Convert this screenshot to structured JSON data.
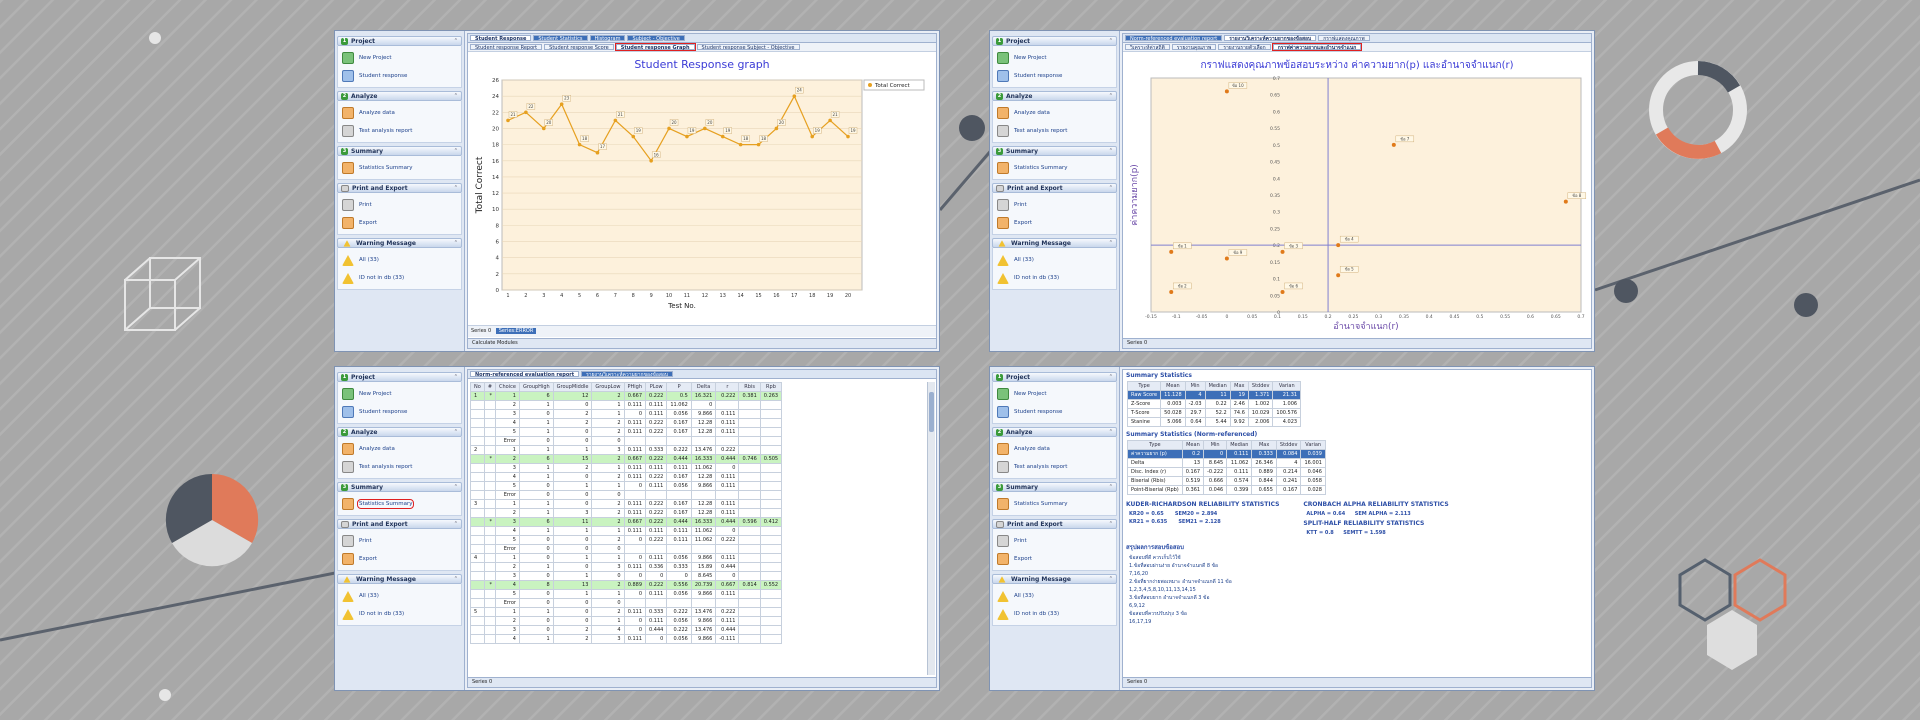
{
  "sidebar": {
    "project": {
      "num": "1",
      "title": "Project",
      "items": [
        "New Project",
        "Student response"
      ]
    },
    "analyze": {
      "num": "2",
      "title": "Analyze",
      "items": [
        "Analyze data",
        "Test analysis report"
      ]
    },
    "summary": {
      "num": "3",
      "title": "Summary",
      "items": [
        "Statistics Summary"
      ]
    },
    "print_export": {
      "title": "Print and Export",
      "items": [
        "Print",
        "Export"
      ]
    },
    "warning": {
      "title": "Warning Message",
      "items": [
        "All (33)",
        "ID not in db (33)"
      ]
    }
  },
  "panel1": {
    "tabs": [
      "Student Response",
      "Student Statistics",
      "Histogram",
      "Subject - Objective"
    ],
    "subtabs": [
      "Student response Report",
      "Student response Score",
      "Student response Graph",
      "Student response Subject - Objective"
    ],
    "status_series": "Series 0",
    "status_active": "Series:ERROR",
    "status_extra": "Calculate Modules",
    "chart_title": "Student Response graph",
    "legend": "Total Correct"
  },
  "panel2": {
    "tabs": [
      "Norm-referenced evaluation report",
      "รายงานวิเคราะห์ความยากของข้อสอบ",
      "กราฟแสดงคุณภาพ"
    ],
    "subtabs": [
      "วิเคราะห์ค่าสถิติ",
      "รายงานคุณภาพ",
      "รายงานรายตัวเลือก",
      "กราฟค่าความยากและอำนาจจำแนก"
    ],
    "chart_title": "กราฟแสดงคุณภาพข้อสอบระหว่าง ค่าความยาก(p) และอำนาจจำแนก(r)",
    "status": "Series 0"
  },
  "panel3": {
    "tabs": [
      "Norm-referenced evaluation report",
      "รายงานวิเคราะห์ความยากของข้อสอบ"
    ],
    "headers": [
      "No",
      "#",
      "Choice",
      "GroupHigh",
      "GroupMiddle",
      "GroupLow",
      "PHigh",
      "PLow",
      "P",
      "Delta",
      "r",
      "Rbis",
      "Rpb"
    ],
    "rows": [
      [
        "1",
        "*",
        "1",
        "6",
        "12",
        "2",
        "0.667",
        "0.222",
        "0.5",
        "16.321",
        "0.222",
        "0.381",
        "0.263"
      ],
      [
        "",
        "",
        "2",
        "1",
        "0",
        "1",
        "0.111",
        "0.111",
        "11.062",
        "0",
        "",
        "",
        ""
      ],
      [
        "",
        "",
        "3",
        "0",
        "2",
        "1",
        "0",
        "0.111",
        "0.056",
        "9.866",
        "0.111",
        "",
        ""
      ],
      [
        "",
        "",
        "4",
        "1",
        "2",
        "2",
        "0.111",
        "0.222",
        "0.167",
        "12.28",
        "0.111",
        "",
        ""
      ],
      [
        "",
        "",
        "5",
        "1",
        "0",
        "2",
        "0.111",
        "0.222",
        "0.167",
        "12.28",
        "0.111",
        "",
        ""
      ],
      [
        "",
        "",
        "Error",
        "0",
        "0",
        "0",
        "",
        "",
        "",
        "",
        "",
        "",
        ""
      ],
      [
        "2",
        "",
        "1",
        "1",
        "1",
        "3",
        "0.111",
        "0.333",
        "0.222",
        "13.476",
        "0.222",
        "",
        ""
      ],
      [
        "",
        "*",
        "2",
        "6",
        "15",
        "2",
        "0.667",
        "0.222",
        "0.444",
        "16.333",
        "0.444",
        "0.746",
        "0.505"
      ],
      [
        "",
        "",
        "3",
        "1",
        "2",
        "1",
        "0.111",
        "0.111",
        "0.111",
        "11.062",
        "0",
        "",
        ""
      ],
      [
        "",
        "",
        "4",
        "1",
        "0",
        "2",
        "0.111",
        "0.222",
        "0.167",
        "12.28",
        "0.111",
        "",
        ""
      ],
      [
        "",
        "",
        "5",
        "0",
        "1",
        "1",
        "0",
        "0.111",
        "0.056",
        "9.866",
        "0.111",
        "",
        ""
      ],
      [
        "",
        "",
        "Error",
        "0",
        "0",
        "0",
        "",
        "",
        "",
        "",
        "",
        "",
        ""
      ],
      [
        "3",
        "",
        "1",
        "1",
        "0",
        "2",
        "0.111",
        "0.222",
        "0.167",
        "12.28",
        "0.111",
        "",
        ""
      ],
      [
        "",
        "",
        "2",
        "1",
        "3",
        "2",
        "0.111",
        "0.222",
        "0.167",
        "12.28",
        "0.111",
        "",
        ""
      ],
      [
        "",
        "*",
        "3",
        "6",
        "11",
        "2",
        "0.667",
        "0.222",
        "0.444",
        "16.333",
        "0.444",
        "0.596",
        "0.412"
      ],
      [
        "",
        "",
        "4",
        "1",
        "1",
        "1",
        "0.111",
        "0.111",
        "0.111",
        "11.062",
        "0",
        "",
        ""
      ],
      [
        "",
        "",
        "5",
        "0",
        "0",
        "2",
        "0",
        "0.222",
        "0.111",
        "11.062",
        "0.222",
        "",
        ""
      ],
      [
        "",
        "",
        "Error",
        "0",
        "0",
        "0",
        "",
        "",
        "",
        "",
        "",
        "",
        ""
      ],
      [
        "4",
        "",
        "1",
        "0",
        "1",
        "1",
        "0",
        "0.111",
        "0.056",
        "9.866",
        "0.111",
        "",
        ""
      ],
      [
        "",
        "",
        "2",
        "1",
        "0",
        "3",
        "0.111",
        "0.336",
        "0.333",
        "15.89",
        "0.444",
        "",
        ""
      ],
      [
        "",
        "",
        "3",
        "0",
        "1",
        "0",
        "0",
        "0",
        "0",
        "8.645",
        "0",
        "",
        ""
      ],
      [
        "",
        "*",
        "4",
        "8",
        "13",
        "2",
        "0.889",
        "0.222",
        "0.556",
        "20.739",
        "0.667",
        "0.814",
        "0.552"
      ],
      [
        "",
        "",
        "5",
        "0",
        "1",
        "1",
        "0",
        "0.111",
        "0.056",
        "9.866",
        "0.111",
        "",
        ""
      ],
      [
        "",
        "",
        "Error",
        "0",
        "0",
        "0",
        "",
        "",
        "",
        "",
        "",
        "",
        ""
      ],
      [
        "5",
        "",
        "1",
        "1",
        "0",
        "2",
        "0.111",
        "0.333",
        "0.222",
        "13.476",
        "0.222",
        "",
        ""
      ],
      [
        "",
        "",
        "2",
        "0",
        "0",
        "1",
        "0",
        "0.111",
        "0.056",
        "9.866",
        "0.111",
        "",
        ""
      ],
      [
        "",
        "",
        "3",
        "0",
        "2",
        "4",
        "0",
        "0.444",
        "0.222",
        "13.476",
        "0.444",
        "",
        ""
      ],
      [
        "",
        "",
        "4",
        "1",
        "2",
        "3",
        "0.111",
        "0",
        "0.056",
        "9.866",
        "-0.111",
        "",
        ""
      ]
    ],
    "status": "Series 0"
  },
  "panel4": {
    "h1": "Summary Statistics",
    "t1_headers": [
      "Type",
      "Mean",
      "Min",
      "Median",
      "Max",
      "Stddev",
      "Varian"
    ],
    "t1_rows": [
      [
        "Raw Score",
        "11.128",
        "4",
        "11",
        "19",
        "1.371",
        "21.31"
      ],
      [
        "Z-Score",
        "0.003",
        "-2.03",
        "0.22",
        "2.46",
        "1.002",
        "1.006"
      ],
      [
        "T-Score",
        "50.028",
        "29.7",
        "52.2",
        "74.6",
        "10.029",
        "100.576"
      ],
      [
        "Stanine",
        "5.066",
        "0.64",
        "5.44",
        "9.92",
        "2.006",
        "4.023"
      ]
    ],
    "h2": "Summary Statistics (Norm-referenced)",
    "t2_headers": [
      "Type",
      "Mean",
      "Min",
      "Median",
      "Max",
      "Stddev",
      "Varian"
    ],
    "t2_rows": [
      [
        "ค่าความยาก (p)",
        "0.2",
        "0",
        "0.111",
        "0.333",
        "0.084",
        "0.039"
      ],
      [
        "Delta",
        "13",
        "8.645",
        "11.062",
        "26.346",
        "4",
        "16.001"
      ],
      [
        "Disc. Index (r)",
        "0.167",
        "-0.222",
        "0.111",
        "0.889",
        "0.214",
        "0.046"
      ],
      [
        "Biserial (Rbis)",
        "0.519",
        "0.666",
        "0.574",
        "0.844",
        "0.241",
        "0.058"
      ],
      [
        "Point-Biserial (Rpb)",
        "0.361",
        "0.046",
        "0.399",
        "0.655",
        "0.167",
        "0.028"
      ]
    ],
    "kr_title": "KUDER-RICHARDSON RELIABILITY STATISTICS",
    "kr20": "KR20 = 0.65",
    "sem20": "SEM20 = 2.894",
    "kr21": "KR21 = 0.635",
    "sem21": "SEM21 = 2.128",
    "cron_title": "CRONBACH ALPHA RELIABILITY STATISTICS",
    "alpha": "ALPHA = 0.64",
    "sem_alpha": "SEM ALPHA = 2.113",
    "split_title": "SPLIT-HALF RELIABILITY STATISTICS",
    "ktt": "KTT = 0.8",
    "semtt": "SEMTT = 1.598",
    "th_head": "สรุปผลการสอบข้อสอบ",
    "th_lines": [
      "ข้อสอบที่ดี ควรเก็บไว้ใช้",
      "1.ข้อที่สอบผ่านง่าย อำนาจจำแนกดี  8 ข้อ",
      "7,16,20",
      "2.ข้อที่ยากง่ายพอเหมาะ อำนาจจำแนกดี  11 ข้อ",
      "1,2,3,4,5,8,10,11,13,14,15",
      "3.ข้อที่สอบยาก อำนาจจำแนกดี  3 ข้อ",
      "6,9,12",
      "ข้อสอบที่ควรปรับปรุง  3 ข้อ",
      "16,17,19"
    ],
    "status": "Series 0"
  },
  "chart_data": [
    {
      "type": "line",
      "title": "Student Response graph",
      "xlabel": "Test No.",
      "ylabel": "Total Correct",
      "x": [
        1,
        2,
        3,
        4,
        5,
        6,
        7,
        8,
        9,
        10,
        11,
        12,
        13,
        14,
        15,
        16,
        17,
        18,
        19,
        20
      ],
      "series": [
        {
          "name": "Total Correct",
          "values": [
            21,
            22,
            20,
            23,
            18,
            17,
            21,
            19,
            16,
            20,
            19,
            20,
            19,
            18,
            18,
            20,
            24,
            19,
            21,
            19
          ]
        }
      ],
      "ylim": [
        0,
        26
      ],
      "yticks": [
        0,
        2,
        4,
        6,
        8,
        10,
        12,
        14,
        16,
        18,
        20,
        22,
        24,
        26
      ],
      "grid": true,
      "legend": "top-right"
    },
    {
      "type": "scatter",
      "title": "กราฟแสดงคุณภาพข้อสอบระหว่าง ค่าความยาก(p) และอำนาจจำแนก(r)",
      "xlabel": "อำนาจจำแนก(r)",
      "ylabel": "ค่าความยาก(p)",
      "xlim": [
        -0.15,
        0.7
      ],
      "ylim": [
        0,
        0.7
      ],
      "xticks": [
        -0.15,
        -0.1,
        -0.05,
        0,
        0.05,
        0.1,
        0.15,
        0.2,
        0.25,
        0.3,
        0.35,
        0.4,
        0.45,
        0.5,
        0.55,
        0.6,
        0.65,
        0.7
      ],
      "yticks": [
        0,
        0.05,
        0.1,
        0.15,
        0.2,
        0.25,
        0.3,
        0.35,
        0.4,
        0.45,
        0.5,
        0.55,
        0.6,
        0.65,
        0.7
      ],
      "points": [
        {
          "label": "ข้อ 1",
          "x": -0.11,
          "y": 0.18
        },
        {
          "label": "ข้อ 2",
          "x": -0.11,
          "y": 0.06
        },
        {
          "label": "ข้อ 3",
          "x": 0.11,
          "y": 0.18
        },
        {
          "label": "ข้อ 4",
          "x": 0.22,
          "y": 0.2
        },
        {
          "label": "ข้อ 5",
          "x": 0.22,
          "y": 0.11
        },
        {
          "label": "ข้อ 6",
          "x": 0.11,
          "y": 0.06
        },
        {
          "label": "ข้อ 7",
          "x": 0.33,
          "y": 0.5
        },
        {
          "label": "ข้อ 8",
          "x": 0.67,
          "y": 0.33
        },
        {
          "label": "ข้อ 9",
          "x": 0.0,
          "y": 0.16
        },
        {
          "label": "ข้อ 10",
          "x": 0.0,
          "y": 0.66
        }
      ],
      "grid": false
    }
  ]
}
